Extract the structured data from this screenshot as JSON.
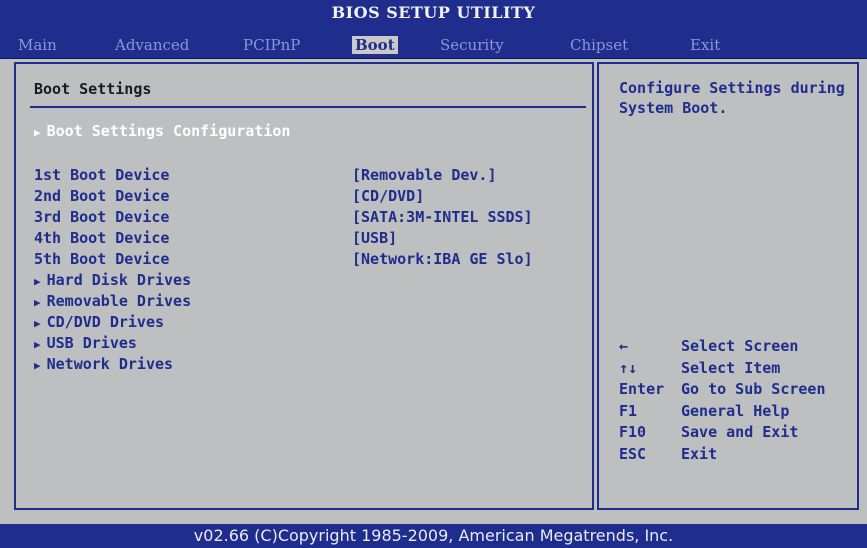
{
  "app_title": "BIOS SETUP UTILITY",
  "menu": [
    "Main",
    "Advanced",
    "PCIPnP",
    "Boot",
    "Security",
    "Chipset",
    "Exit"
  ],
  "active_tab": "Boot",
  "main": {
    "section_title": "Boot Settings",
    "config_item": "Boot Settings Configuration",
    "boot_devices": [
      {
        "label": "1st Boot Device",
        "value": "[Removable Dev.]"
      },
      {
        "label": "2nd Boot Device",
        "value": "[CD/DVD]"
      },
      {
        "label": "3rd Boot Device",
        "value": "[SATA:3M-INTEL SSDS]"
      },
      {
        "label": "4th Boot Device",
        "value": "[USB]"
      },
      {
        "label": "5th Boot Device",
        "value": "[Network:IBA GE Slo]"
      }
    ],
    "submenus": [
      "Hard Disk Drives",
      "Removable Drives",
      "CD/DVD Drives",
      "USB Drives",
      "Network Drives"
    ]
  },
  "side": {
    "help_text": "Configure Settings during System Boot.",
    "keys": [
      {
        "key": "←",
        "desc": "Select Screen"
      },
      {
        "key": "↑↓",
        "desc": "Select Item"
      },
      {
        "key": "Enter",
        "desc": "Go to Sub Screen"
      },
      {
        "key": "F1",
        "desc": "General Help"
      },
      {
        "key": "F10",
        "desc": "Save and Exit"
      },
      {
        "key": "ESC",
        "desc": "Exit"
      }
    ]
  },
  "footer": "v02.66 (C)Copyright 1985-2009, American Megatrends, Inc.",
  "colors": {
    "panel_bg": "#bdbfc0",
    "accent": "#1f2d8c",
    "highlight": "#ffffff"
  }
}
